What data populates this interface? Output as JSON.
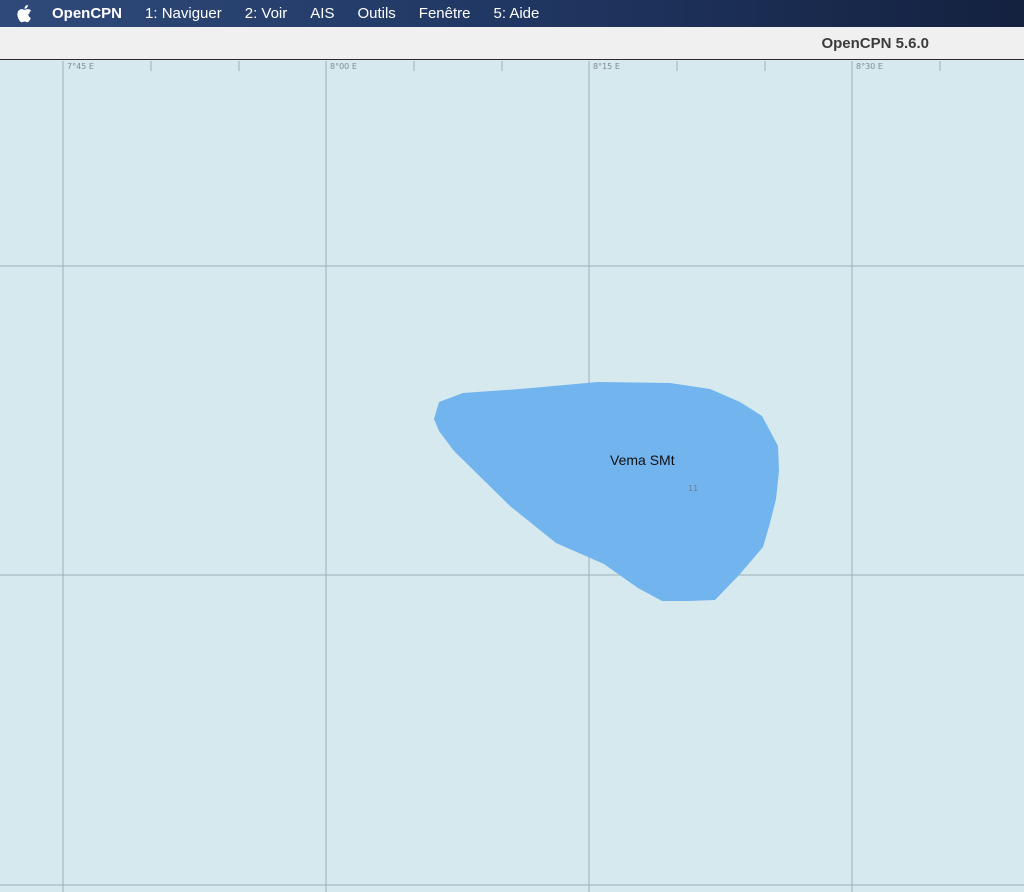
{
  "menubar": {
    "apple_icon": "apple-logo-icon",
    "app_name": "OpenCPN",
    "items": [
      "1: Naviguer",
      "2: Voir",
      "AIS",
      "Outils",
      "Fenêtre",
      "5: Aide"
    ]
  },
  "window": {
    "title": "OpenCPN 5.6.0"
  },
  "chart": {
    "background_color": "#d5e9ef",
    "grid_color": "#9fb0b7",
    "longitude_labels": [
      "7°45 E",
      "8°00 E",
      "8°15 E",
      "8°30 E"
    ],
    "seamount": {
      "name": "Vema SMt",
      "depth": "11",
      "fill_color": "#72b4ee"
    }
  }
}
